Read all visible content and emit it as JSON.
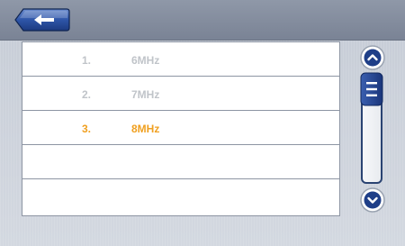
{
  "header": {
    "back_icon": "left-arrow-icon"
  },
  "list": {
    "rows": [
      {
        "number": "1.",
        "value": "6MHz",
        "state": "normal"
      },
      {
        "number": "2.",
        "value": "7MHz",
        "state": "normal"
      },
      {
        "number": "3.",
        "value": "8MHz",
        "state": "selected"
      },
      {
        "number": "",
        "value": "",
        "state": "empty"
      },
      {
        "number": "",
        "value": "",
        "state": "empty"
      }
    ]
  },
  "scrollbar": {
    "up_icon": "chevron-up-icon",
    "down_icon": "chevron-down-icon",
    "thumb_icon": "grip-lines-icon",
    "position": 0
  },
  "colors": {
    "selected_text": "#f0a020",
    "dim_text": "#c0c4c9",
    "accent_blue": "#1f3f88"
  }
}
